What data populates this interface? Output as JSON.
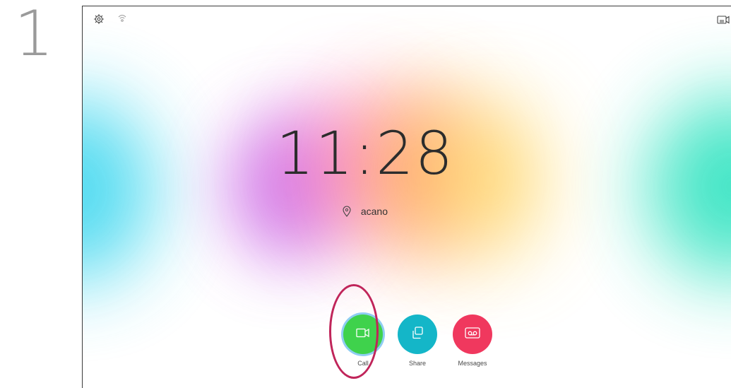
{
  "step": {
    "number": "1"
  },
  "topbar": {
    "settings_icon": "gear-icon",
    "wifi_icon": "wifi-icon",
    "camera_status_icon": "camera-status-icon"
  },
  "home": {
    "time": "11:28",
    "location": "acano",
    "location_icon": "location-pin-icon"
  },
  "actions": [
    {
      "label": "Call",
      "icon": "video-camera-icon",
      "color": "#3fd24c"
    },
    {
      "label": "Share",
      "icon": "share-screens-icon",
      "color": "#14b6c8"
    },
    {
      "label": "Messages",
      "icon": "voicemail-icon",
      "color": "#f0385e"
    }
  ],
  "annotation": {
    "highlight_color": "#c0255a",
    "highlighted_action": "Call"
  }
}
